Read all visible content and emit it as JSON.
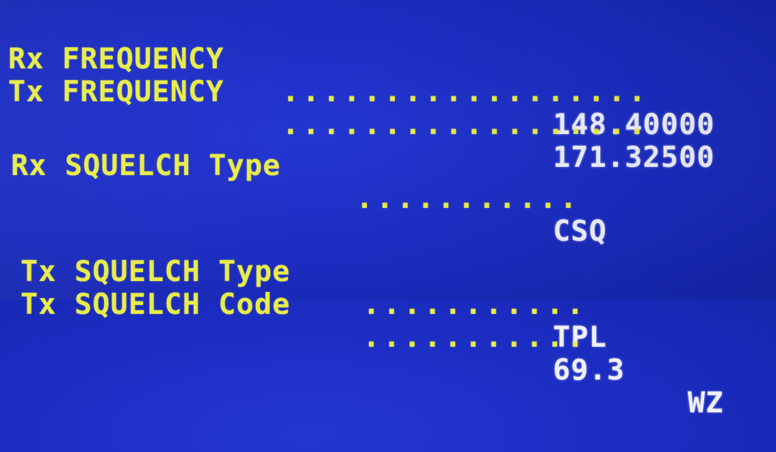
{
  "settings": {
    "rx_frequency": {
      "label": "Rx FREQUENCY",
      "leader": "..................",
      "value": "148.40000"
    },
    "tx_frequency": {
      "label": "Tx FREQUENCY",
      "leader": "..................",
      "value": "171.32500"
    },
    "rx_squelch_type": {
      "label": "Rx SQUELCH Type",
      "leader": "...........",
      "value": "CSQ"
    },
    "tx_squelch_type": {
      "label": "Tx SQUELCH Type",
      "leader": "...........",
      "value": "TPL"
    },
    "tx_squelch_code": {
      "label": "Tx SQUELCH Code",
      "leader": "...........",
      "value": "69.3",
      "unit": "WZ"
    }
  },
  "colors": {
    "background": "#1a2fc4",
    "label_text": "#e8ec4a",
    "value_text": "#eef0ff"
  }
}
